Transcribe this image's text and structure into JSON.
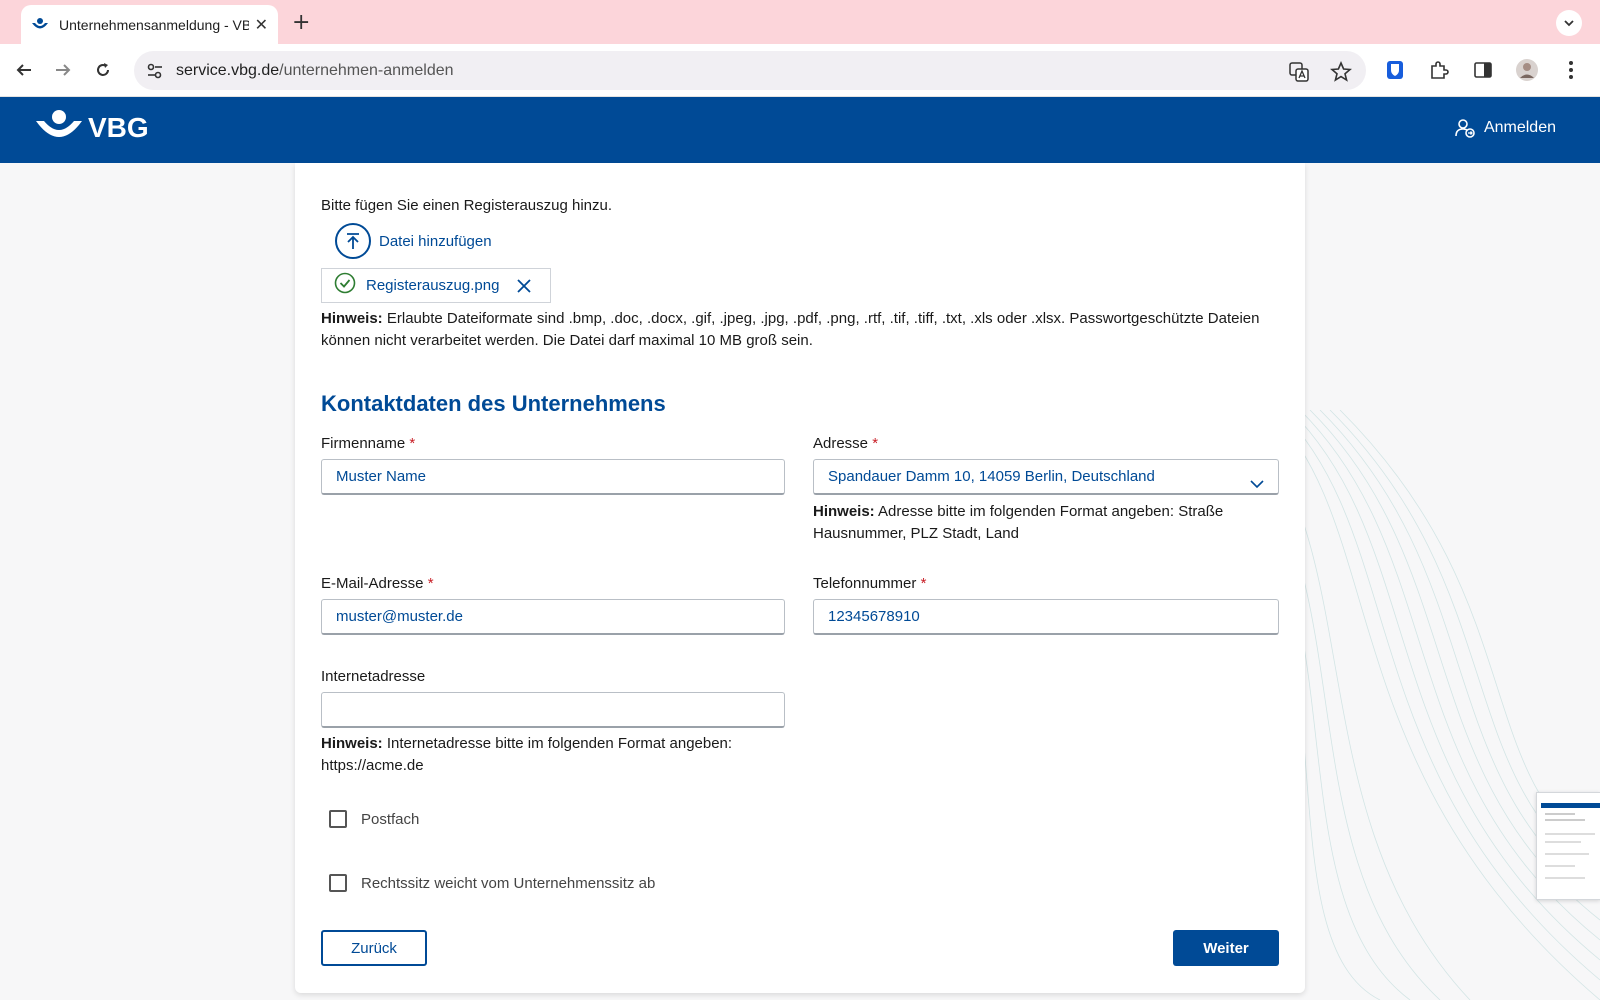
{
  "browser": {
    "tab_title": "Unternehmensanmeldung - VBG",
    "url_host": "service.vbg.de",
    "url_path": "/unternehmen-anmelden",
    "new_tab_symbol": "+",
    "tab_close_symbol": "✕"
  },
  "header": {
    "logo_text": "VBG",
    "login_label": "Anmelden"
  },
  "upload": {
    "prompt": "Bitte fügen Sie einen Registerauszug hinzu.",
    "add_file_label": "Datei hinzufügen",
    "file_name": "Registerauszug.png",
    "hint_label": "Hinweis:",
    "hint_text": " Erlaubte Dateiformate sind .bmp, .doc, .docx, .gif, .jpeg, .jpg, .pdf, .png, .rtf, .tif, .tiff, .txt, .xls oder .xlsx. Passwortgeschützte Dateien können nicht verarbeitet werden. Die Datei darf maximal 10 MB groß sein."
  },
  "contact": {
    "section_title": "Kontaktdaten des Unternehmens",
    "required_marker": "*",
    "company_name": {
      "label": "Firmenname",
      "value": "Muster Name"
    },
    "address": {
      "label": "Adresse",
      "value": "Spandauer Damm 10, 14059 Berlin, Deutschland",
      "hint_label": "Hinweis:",
      "hint_text": " Adresse bitte im folgenden Format angeben: Straße Hausnummer, PLZ Stadt, Land"
    },
    "email": {
      "label": "E-Mail-Adresse",
      "value": "muster@muster.de"
    },
    "phone": {
      "label": "Telefonnummer",
      "value": "12345678910"
    },
    "website": {
      "label": "Internetadresse",
      "value": "",
      "hint_label": "Hinweis:",
      "hint_text": " Internetadresse bitte im folgenden Format angeben: https://acme.de"
    },
    "checkboxes": [
      {
        "label": "Postfach",
        "checked": false
      },
      {
        "label": "Rechtssitz weicht vom Unternehmenssitz ab",
        "checked": false
      }
    ]
  },
  "actions": {
    "back_label": "Zurück",
    "next_label": "Weiter"
  },
  "colors": {
    "brand_blue": "#004a96",
    "tabbar_pink": "#fcd5da",
    "required_red": "#c81d25",
    "success_green": "#2e7d32"
  }
}
